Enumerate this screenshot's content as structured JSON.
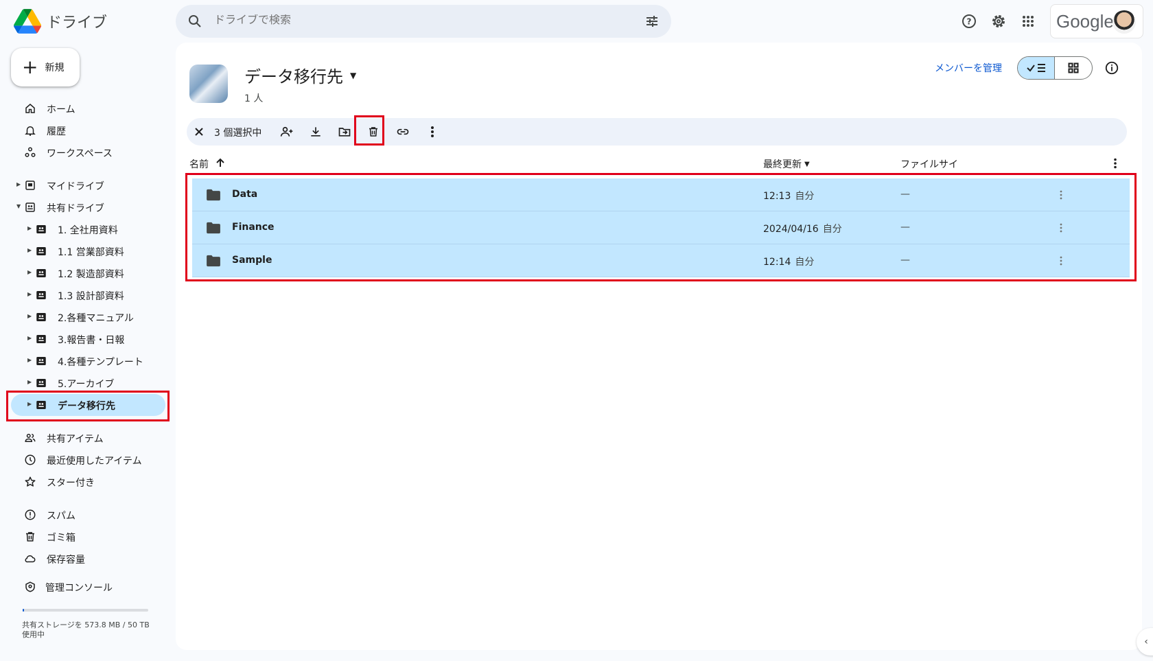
{
  "app": {
    "name": "ドライブ"
  },
  "search": {
    "placeholder": "ドライブで検索"
  },
  "account": {
    "brand": "Google"
  },
  "sidebar": {
    "new_label": "新規",
    "primary": [
      {
        "label": "ホーム",
        "icon": "home-icon"
      },
      {
        "label": "履歴",
        "icon": "bell-icon"
      },
      {
        "label": "ワークスペース",
        "icon": "workspaces-icon"
      }
    ],
    "my_drive": "マイドライブ",
    "shared_drives": "共有ドライブ",
    "shared_drive_items": [
      "1. 全社用資料",
      "1.1 営業部資料",
      "1.2 製造部資料",
      "1.3 設計部資料",
      "2.各種マニュアル",
      "3.報告書・日報",
      "4.各種テンプレート",
      "5.アーカイブ",
      "データ移行先"
    ],
    "secondary": [
      {
        "label": "共有アイテム",
        "icon": "people-icon"
      },
      {
        "label": "最近使用したアイテム",
        "icon": "clock-icon"
      },
      {
        "label": "スター付き",
        "icon": "star-icon"
      }
    ],
    "tertiary": [
      {
        "label": "スパム",
        "icon": "spam-icon"
      },
      {
        "label": "ゴミ箱",
        "icon": "trash-icon"
      },
      {
        "label": "保存容量",
        "icon": "cloud-icon"
      }
    ],
    "admin_console": "管理コンソール",
    "storage_text": "共有ストレージを 573.8 MB / 50 TB 使用中",
    "storage_used_fraction": 0.01
  },
  "main": {
    "drive_title": "データ移行先",
    "member_count": "1 人",
    "manage_members": "メンバーを管理",
    "selection_count": "3 個選択中",
    "columns": {
      "name": "名前",
      "modified": "最終更新",
      "size": "ファイルサイ"
    },
    "rows": [
      {
        "name": "Data",
        "modified": "12:13",
        "owner": "自分",
        "size": "—"
      },
      {
        "name": "Finance",
        "modified": "2024/04/16",
        "owner": "自分",
        "size": "—"
      },
      {
        "name": "Sample",
        "modified": "12:14",
        "owner": "自分",
        "size": "—"
      }
    ]
  },
  "colors": {
    "accent": "#0b57d0",
    "selected": "#c2e7ff",
    "highlight": "#e0001b"
  }
}
